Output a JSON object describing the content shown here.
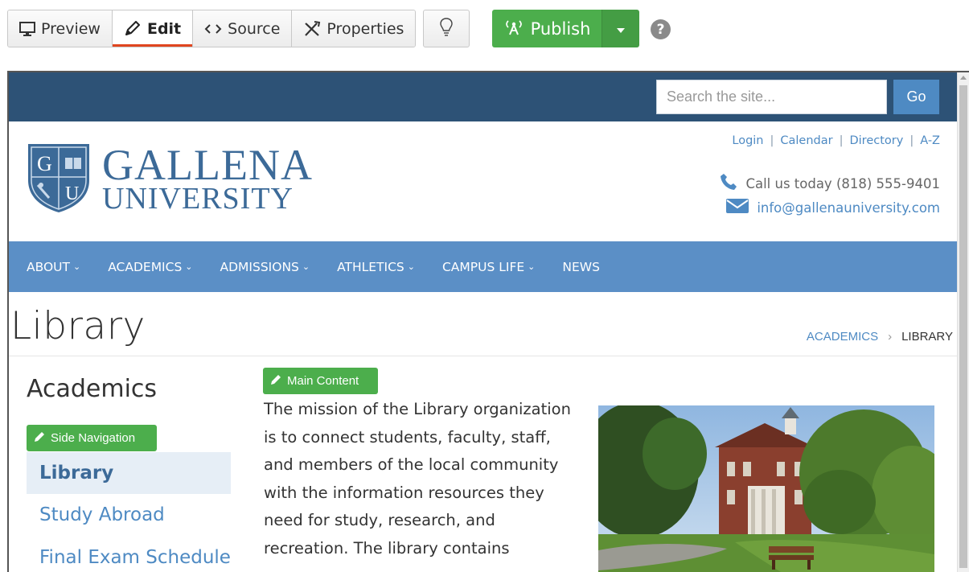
{
  "toolbar": {
    "preview_label": "Preview",
    "edit_label": "Edit",
    "source_label": "Source",
    "properties_label": "Properties",
    "publish_label": "Publish",
    "help_label": "?",
    "accent_color": "#4cae4c",
    "active_underline_color": "#e0461f",
    "icons": [
      "monitor-icon",
      "pencil-icon",
      "code-icon",
      "tools-icon",
      "lightbulb-icon",
      "broadcast-icon",
      "caret-down-icon",
      "help-icon"
    ]
  },
  "site": {
    "search": {
      "placeholder": "Search the site...",
      "button_label": "Go"
    },
    "logo": {
      "line1": "GALLENA",
      "line2": "UNIVERSITY",
      "shield_letters": [
        "G",
        "U"
      ]
    },
    "utility_links": [
      "Login",
      "Calendar",
      "Directory",
      "A-Z"
    ],
    "phone_text": "Call us today (818) 555-9401",
    "email_text": "info@gallenauniversity.com",
    "nav": [
      {
        "label": "ABOUT",
        "dropdown": true
      },
      {
        "label": "ACADEMICS",
        "dropdown": true
      },
      {
        "label": "ADMISSIONS",
        "dropdown": true
      },
      {
        "label": "ATHLETICS",
        "dropdown": true
      },
      {
        "label": "CAMPUS LIFE",
        "dropdown": true
      },
      {
        "label": "NEWS",
        "dropdown": false
      }
    ],
    "brand_colors": {
      "topbar": "#2d5276",
      "nav": "#5b8fc6",
      "link": "#4e8ac3"
    }
  },
  "page": {
    "title": "Library",
    "breadcrumb": [
      "ACADEMICS",
      "LIBRARY"
    ],
    "sidebar": {
      "title": "Academics",
      "edit_badge": "Side Navigation",
      "items": [
        "Library",
        "Study Abroad",
        "Final Exam Schedule"
      ],
      "active_index": 0
    },
    "main": {
      "edit_badge": "Main Content",
      "lines": [
        "The mission of the Library organization",
        "is to connect students, faculty, staff,",
        "and members of the local community",
        "with the information resources they",
        "need for study, research, and",
        "recreation. The library contains"
      ]
    }
  }
}
